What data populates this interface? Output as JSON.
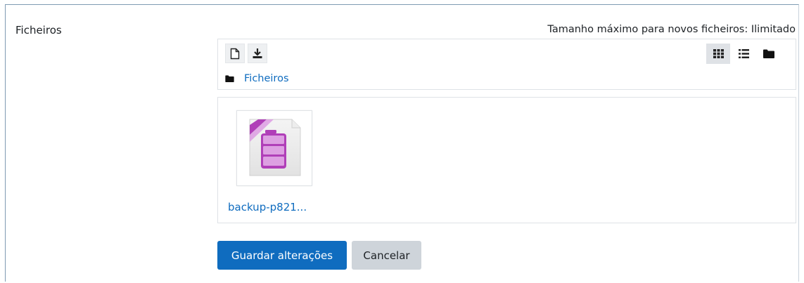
{
  "field": {
    "label": "Ficheiros",
    "max_size_text": "Tamanho máximo para novos ficheiros: Ilimitado"
  },
  "toolbar": {
    "add_file_icon": "file-icon",
    "download_icon": "download-icon",
    "views": [
      {
        "name": "icons-view",
        "icon": "grid-icon",
        "active": true
      },
      {
        "name": "list-view",
        "icon": "list-icon",
        "active": false
      },
      {
        "name": "tree-view",
        "icon": "folder-icon",
        "active": false
      }
    ]
  },
  "breadcrumb": {
    "icon": "folder-icon",
    "label": "Ficheiros"
  },
  "files": [
    {
      "name": "backup-p821...",
      "icon": "archive-file-icon"
    }
  ],
  "actions": {
    "save_label": "Guardar alterações",
    "cancel_label": "Cancelar"
  },
  "colors": {
    "primary": "#0f6cbf",
    "secondary": "#ced4da",
    "file_icon_purple": "#b03fb8"
  }
}
